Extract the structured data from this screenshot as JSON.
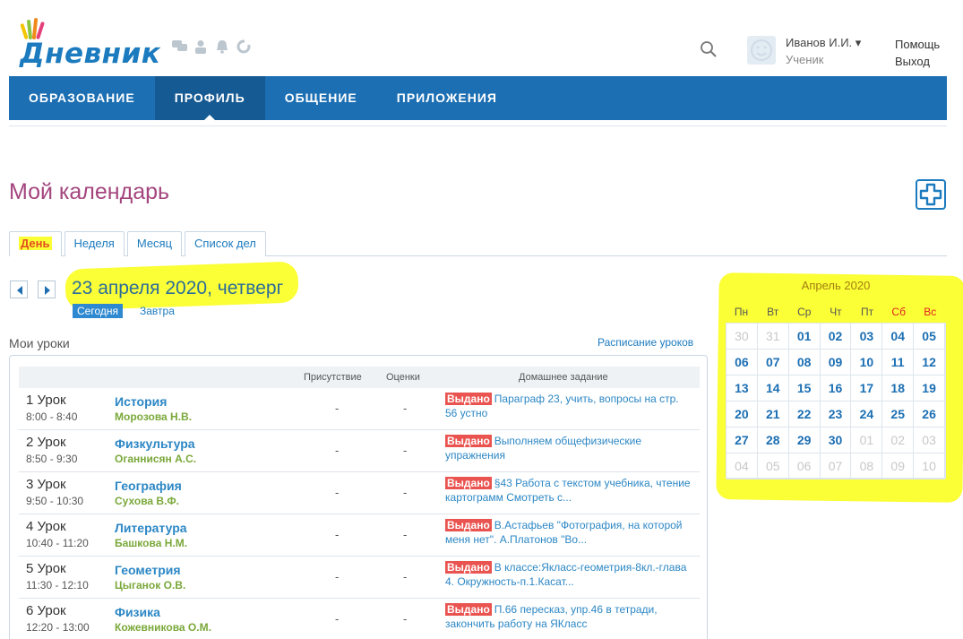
{
  "header": {
    "logo_text": "Дневник",
    "user_name": "Иванов И.И. ▾",
    "user_role": "Ученик",
    "help": "Помощь",
    "exit": "Выход"
  },
  "nav": {
    "items": [
      "ОБРАЗОВАНИЕ",
      "ПРОФИЛЬ",
      "ОБЩЕНИЕ",
      "ПРИЛОЖЕНИЯ"
    ],
    "active": 1
  },
  "page": {
    "title": "Мой календарь",
    "tabs": [
      "День",
      "Неделя",
      "Месяц",
      "Список дел"
    ],
    "active_tab": 0,
    "date": "23 апреля 2020, четверг",
    "today": "Сегодня",
    "tomorrow": "Завтра",
    "lessons_label": "Мои уроки",
    "schedule_link": "Расписание уроков"
  },
  "lessons_table": {
    "columns": [
      "Присутствие",
      "Оценки",
      "Домашнее задание"
    ],
    "hw_badge": "Выдано",
    "rows": [
      {
        "num": "1 Урок",
        "time": "8:00 - 8:40",
        "subject": "История",
        "teacher": "Морозова Н.В.",
        "attendance": "-",
        "grade": "-",
        "hw": "Параграф 23, учить, вопросы на стр. 56 устно"
      },
      {
        "num": "2 Урок",
        "time": "8:50 - 9:30",
        "subject": "Физкультура",
        "teacher": "Оганнисян А.С.",
        "attendance": "-",
        "grade": "-",
        "hw": "Выполняем общефизические упражнения"
      },
      {
        "num": "3 Урок",
        "time": "9:50 - 10:30",
        "subject": "География",
        "teacher": "Сухова В.Ф.",
        "attendance": "-",
        "grade": "-",
        "hw": "§43 Работа с текстом учебника, чтение картограмм Смотреть с..."
      },
      {
        "num": "4 Урок",
        "time": "10:40 - 11:20",
        "subject": "Литература",
        "teacher": "Башкова Н.М.",
        "attendance": "-",
        "grade": "-",
        "hw": "В.Астафьев \"Фотография, на которой меня нет\". А.Платонов \"Во..."
      },
      {
        "num": "5 Урок",
        "time": "11:30 - 12:10",
        "subject": "Геометрия",
        "teacher": "Цыганок О.В.",
        "attendance": "-",
        "grade": "-",
        "hw": "В классе:Якласс-геометрия-8кл.-глава 4. Окружность-п.1.Касат..."
      },
      {
        "num": "6 Урок",
        "time": "12:20 - 13:00",
        "subject": "Физика",
        "teacher": "Кожевникова О.М.",
        "attendance": "-",
        "grade": "-",
        "hw": "П.66 пересказ, упр.46 в тетради, закончить работу на ЯКласс"
      }
    ]
  },
  "calendar": {
    "title": "Апрель 2020",
    "weekdays": [
      "Пн",
      "Вт",
      "Ср",
      "Чт",
      "Пт",
      "Сб",
      "Вс"
    ],
    "days": [
      {
        "d": "30",
        "m": true
      },
      {
        "d": "31",
        "m": true
      },
      {
        "d": "01"
      },
      {
        "d": "02"
      },
      {
        "d": "03"
      },
      {
        "d": "04"
      },
      {
        "d": "05"
      },
      {
        "d": "06"
      },
      {
        "d": "07"
      },
      {
        "d": "08"
      },
      {
        "d": "09"
      },
      {
        "d": "10"
      },
      {
        "d": "11"
      },
      {
        "d": "12"
      },
      {
        "d": "13"
      },
      {
        "d": "14"
      },
      {
        "d": "15"
      },
      {
        "d": "16"
      },
      {
        "d": "17"
      },
      {
        "d": "18"
      },
      {
        "d": "19"
      },
      {
        "d": "20"
      },
      {
        "d": "21"
      },
      {
        "d": "22"
      },
      {
        "d": "23"
      },
      {
        "d": "24"
      },
      {
        "d": "25"
      },
      {
        "d": "26"
      },
      {
        "d": "27"
      },
      {
        "d": "28"
      },
      {
        "d": "29"
      },
      {
        "d": "30"
      },
      {
        "d": "01",
        "m": true
      },
      {
        "d": "02",
        "m": true
      },
      {
        "d": "03",
        "m": true
      },
      {
        "d": "04",
        "m": true
      },
      {
        "d": "05",
        "m": true
      },
      {
        "d": "06",
        "m": true
      },
      {
        "d": "07",
        "m": true
      },
      {
        "d": "08",
        "m": true
      },
      {
        "d": "09",
        "m": true
      },
      {
        "d": "10",
        "m": true
      }
    ]
  },
  "colors": {
    "brand_blue": "#1c6fb3",
    "highlight": "#fbff35",
    "title_purple": "#a4457e",
    "badge_red": "#ea5450"
  }
}
